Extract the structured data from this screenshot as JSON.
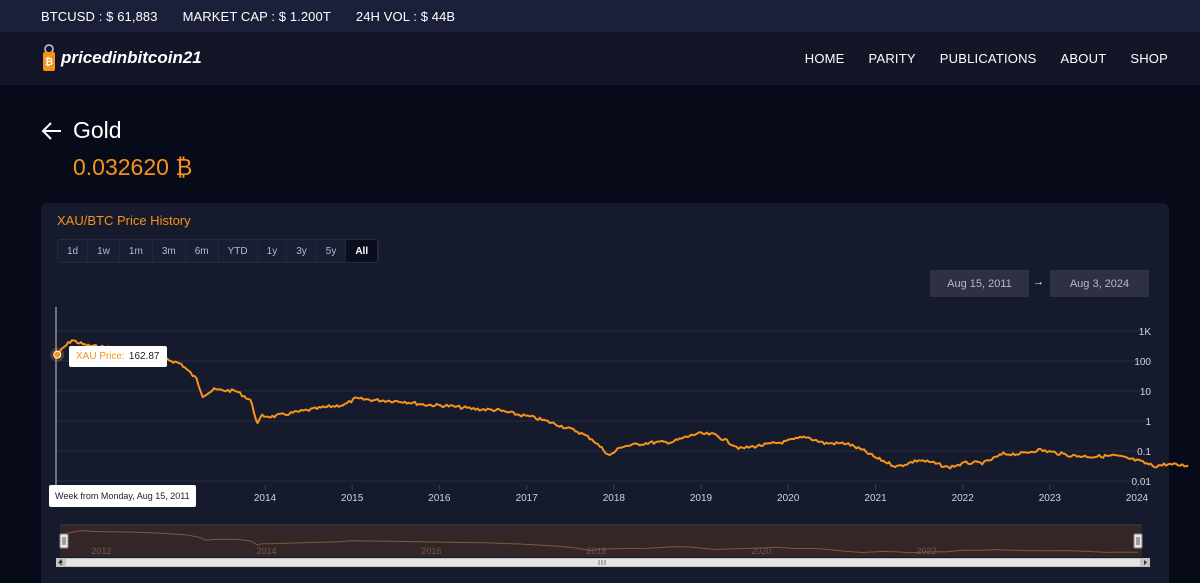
{
  "ticker": {
    "btcusd": "BTCUSD : $ 61,883",
    "market_cap": "MARKET CAP : $ 1.200T",
    "vol": "24H VOL : $ 44B"
  },
  "brand": {
    "name": "pricedinbitcoin21"
  },
  "nav": [
    {
      "label": "HOME"
    },
    {
      "label": "PARITY"
    },
    {
      "label": "PUBLICATIONS"
    },
    {
      "label": "ABOUT"
    },
    {
      "label": "SHOP"
    }
  ],
  "asset": {
    "name": "Gold",
    "price": "0.032620 ₿"
  },
  "panel": {
    "title": "XAU/BTC Price History"
  },
  "ranges": [
    {
      "label": "1d"
    },
    {
      "label": "1w"
    },
    {
      "label": "1m"
    },
    {
      "label": "3m"
    },
    {
      "label": "6m"
    },
    {
      "label": "YTD"
    },
    {
      "label": "1y"
    },
    {
      "label": "3y"
    },
    {
      "label": "5y"
    },
    {
      "label": "All",
      "active": true
    }
  ],
  "date_range": {
    "from": "Aug 15, 2011",
    "arrow": "→",
    "to": "Aug 3, 2024"
  },
  "tooltip": {
    "series": "XAU Price:",
    "value": "162.87",
    "x_label": "Week from Monday, Aug 15, 2011"
  },
  "colors": {
    "accent": "#f7931a",
    "background": "#070b19",
    "panel": "#161a2d"
  },
  "chart_data": {
    "type": "line",
    "y_scale": "log",
    "ylim": [
      0.01,
      1000
    ],
    "y_ticks": [
      "1K",
      "100",
      "10",
      "1",
      "0.1",
      "0.01"
    ],
    "x_ticks": [
      "2014",
      "2015",
      "2016",
      "2017",
      "2018",
      "2019",
      "2020",
      "2021",
      "2022",
      "2023",
      "2024"
    ],
    "navigator_ticks": [
      "2012",
      "2014",
      "2016",
      "2018",
      "2020",
      "2022"
    ],
    "grid": true,
    "series": [
      {
        "name": "XAU Price",
        "color": "#f7931a",
        "points": [
          [
            "2011-08-15",
            162.87
          ],
          [
            "2011-09-15",
            300
          ],
          [
            "2011-10-15",
            500
          ],
          [
            "2011-11-15",
            400
          ],
          [
            "2011-12-15",
            330
          ],
          [
            "2012-02-01",
            300
          ],
          [
            "2012-06-01",
            250
          ],
          [
            "2012-10-01",
            150
          ],
          [
            "2013-01-15",
            80
          ],
          [
            "2013-03-20",
            25
          ],
          [
            "2013-04-15",
            7
          ],
          [
            "2013-06-01",
            11
          ],
          [
            "2013-09-01",
            10
          ],
          [
            "2013-11-01",
            5
          ],
          [
            "2013-12-01",
            0.8
          ],
          [
            "2013-12-20",
            1.5
          ],
          [
            "2014-02-01",
            1.4
          ],
          [
            "2014-06-01",
            2.1
          ],
          [
            "2014-09-01",
            2.8
          ],
          [
            "2014-12-01",
            3.5
          ],
          [
            "2015-01-15",
            5.5
          ],
          [
            "2015-04-01",
            5.0
          ],
          [
            "2015-08-01",
            4.5
          ],
          [
            "2015-11-01",
            3.5
          ],
          [
            "2016-02-01",
            3.2
          ],
          [
            "2016-06-01",
            2.5
          ],
          [
            "2016-09-01",
            2.3
          ],
          [
            "2016-12-01",
            1.6
          ],
          [
            "2017-02-01",
            1.3
          ],
          [
            "2017-05-01",
            0.8
          ],
          [
            "2017-08-01",
            0.45
          ],
          [
            "2017-10-01",
            0.25
          ],
          [
            "2017-12-15",
            0.07
          ],
          [
            "2018-02-01",
            0.14
          ],
          [
            "2018-06-01",
            0.19
          ],
          [
            "2018-09-01",
            0.2
          ],
          [
            "2018-12-15",
            0.38
          ],
          [
            "2019-03-01",
            0.35
          ],
          [
            "2019-06-15",
            0.12
          ],
          [
            "2019-09-01",
            0.15
          ],
          [
            "2019-12-15",
            0.2
          ],
          [
            "2020-03-15",
            0.3
          ],
          [
            "2020-06-01",
            0.18
          ],
          [
            "2020-09-01",
            0.18
          ],
          [
            "2020-11-15",
            0.1
          ],
          [
            "2021-01-01",
            0.06
          ],
          [
            "2021-04-01",
            0.03
          ],
          [
            "2021-07-01",
            0.05
          ],
          [
            "2021-09-01",
            0.04
          ],
          [
            "2021-11-01",
            0.028
          ],
          [
            "2022-01-15",
            0.04
          ],
          [
            "2022-04-01",
            0.04
          ],
          [
            "2022-06-20",
            0.08
          ],
          [
            "2022-09-01",
            0.08
          ],
          [
            "2022-11-15",
            0.11
          ],
          [
            "2023-02-01",
            0.085
          ],
          [
            "2023-04-01",
            0.07
          ],
          [
            "2023-07-01",
            0.065
          ],
          [
            "2023-10-01",
            0.07
          ],
          [
            "2024-01-01",
            0.048
          ],
          [
            "2024-03-15",
            0.031
          ],
          [
            "2024-05-01",
            0.036
          ],
          [
            "2024-08-03",
            0.0326
          ]
        ]
      }
    ]
  }
}
